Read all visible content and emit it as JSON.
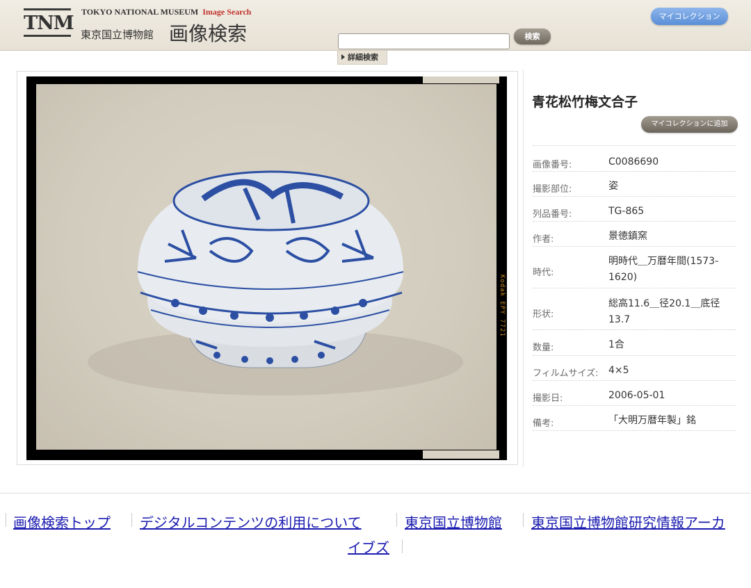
{
  "header": {
    "logo_text": "TNM",
    "brand_en": "TOKYO NATIONAL MUSEUM",
    "brand_en_accent": "Image Search",
    "brand_jp": "東京国立博物館",
    "brand_title": "画像検索",
    "search_value": "",
    "search_button": "検索",
    "advanced_search": "詳細検索",
    "my_collection": "マイコレクション"
  },
  "image": {
    "film_edge_text": "Kodak EPY 7721",
    "description": "青花松竹梅文合子"
  },
  "detail": {
    "title": "青花松竹梅文合子",
    "add_button": "マイコレクションに追加",
    "fields": [
      {
        "label": "画像番号:",
        "value": "C0086690"
      },
      {
        "label": "撮影部位:",
        "value": "姿"
      },
      {
        "label": "列品番号:",
        "value": "TG-865"
      },
      {
        "label": "作者:",
        "value": "景徳鎮窯"
      },
      {
        "label": "時代:",
        "value": "明時代＿万暦年間(1573-1620)"
      },
      {
        "label": "形状:",
        "value": "総高11.6＿径20.1＿底径13.7"
      },
      {
        "label": "数量:",
        "value": "1合"
      },
      {
        "label": "フィルムサイズ:",
        "value": "4×5"
      },
      {
        "label": "撮影日:",
        "value": "2006-05-01"
      },
      {
        "label": "備考:",
        "value": "「大明万暦年製」銘"
      }
    ]
  },
  "footer": {
    "links": [
      "画像検索トップ",
      "デジタルコンテンツの利用について",
      "東京国立博物館",
      "東京国立博物館研究情報アーカ",
      "イブズ"
    ]
  },
  "colors": {
    "header_bg": "#ece7dc",
    "link": "#1a1ab0",
    "my_collection_btn": "#6f9fe0",
    "grey_btn": "#857e73"
  }
}
